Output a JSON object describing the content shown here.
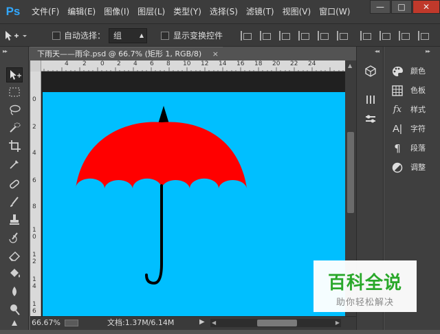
{
  "app": {
    "logo": "Ps"
  },
  "menu": [
    "文件(F)",
    "编辑(E)",
    "图像(I)",
    "图层(L)",
    "类型(Y)",
    "选择(S)",
    "滤镜(T)",
    "视图(V)",
    "窗口(W)"
  ],
  "window_controls": {
    "minimize": "—",
    "restore": "□",
    "close": "✕"
  },
  "options": {
    "auto_select_label": "自动选择：",
    "auto_select_value": "组",
    "show_transform_label": "显示变换控件"
  },
  "document": {
    "tab_title": "下雨天——雨伞.psd @ 66.7% (矩形 1, RGB/8)",
    "close": "×"
  },
  "ruler": {
    "top": [
      "4",
      "2",
      "0",
      "2",
      "4",
      "6",
      "8",
      "10",
      "12",
      "14",
      "16",
      "18",
      "20",
      "22",
      "24"
    ],
    "left": [
      "0",
      "2",
      "4",
      "6",
      "8",
      "1 0",
      "1 2",
      "1 4",
      "1 6"
    ]
  },
  "status": {
    "zoom": "66.67%",
    "doc_info": "文档:1.37M/6.14M"
  },
  "panels": [
    {
      "icon": "palette-icon",
      "label": "颜色"
    },
    {
      "icon": "swatches-icon",
      "label": "色板"
    },
    {
      "icon": "fx-icon",
      "label": "样式"
    },
    {
      "icon": "character-icon",
      "label": "字符"
    },
    {
      "icon": "paragraph-icon",
      "label": "段落"
    },
    {
      "icon": "adjustments-icon",
      "label": "调整"
    }
  ],
  "colors": {
    "canvas": "#00bfff",
    "umbrella": "#ff0000",
    "pasteboard": "#202020",
    "ps_blue": "#31a8ff"
  },
  "watermark": {
    "title": "百科全说",
    "subtitle": "助你轻松解决"
  }
}
